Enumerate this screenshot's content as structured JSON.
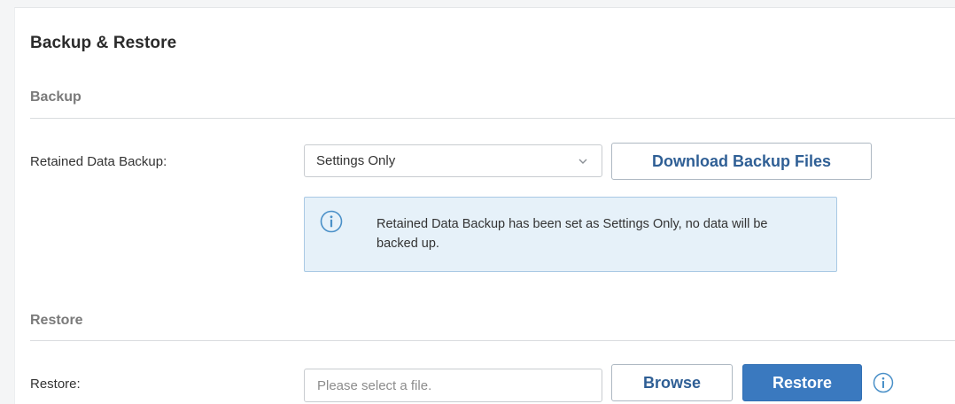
{
  "page": {
    "title": "Backup & Restore"
  },
  "backup": {
    "section_title": "Backup",
    "retained_label": "Retained Data Backup:",
    "retained_select": {
      "selected": "Settings Only",
      "icon": "chevron-down-icon"
    },
    "download_button": "Download Backup Files",
    "notice": {
      "icon": "info-icon",
      "text": "Retained Data Backup has been set as Settings Only, no data will be backed up."
    }
  },
  "restore": {
    "section_title": "Restore",
    "restore_label": "Restore:",
    "file_input": {
      "value": "",
      "placeholder": "Please select a file."
    },
    "browse_button": "Browse",
    "restore_button": "Restore",
    "help_icon": "info-icon"
  },
  "colors": {
    "primary": "#3a79bf",
    "link_text": "#2f5f95",
    "notice_bg": "#e6f1f9",
    "notice_border": "#a9c9e4",
    "info_icon": "#4a90c8"
  }
}
